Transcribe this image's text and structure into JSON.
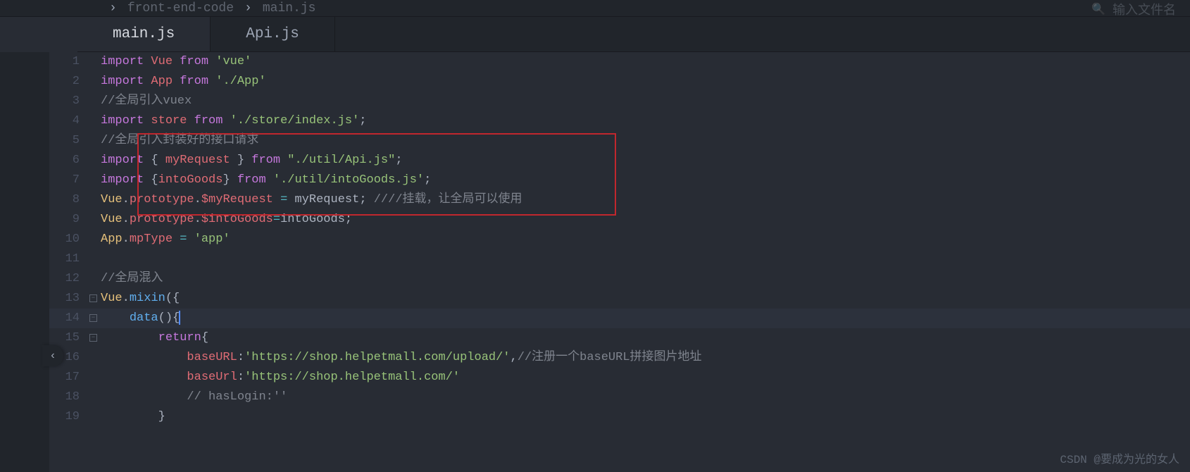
{
  "breadcrumb": {
    "item1": "front-end-code",
    "item2": "main.js",
    "sep": "›"
  },
  "search": {
    "placeholder": "输入文件名"
  },
  "tabs": {
    "tab1": "main.js",
    "tab2": "Api.js"
  },
  "code": {
    "lines": [
      {
        "num": "1",
        "tokens": [
          [
            "kw",
            "import"
          ],
          [
            "plain",
            " "
          ],
          [
            "var",
            "Vue"
          ],
          [
            "plain",
            " "
          ],
          [
            "kw",
            "from"
          ],
          [
            "plain",
            " "
          ],
          [
            "str",
            "'vue'"
          ]
        ]
      },
      {
        "num": "2",
        "tokens": [
          [
            "kw",
            "import"
          ],
          [
            "plain",
            " "
          ],
          [
            "var",
            "App"
          ],
          [
            "plain",
            " "
          ],
          [
            "kw",
            "from"
          ],
          [
            "plain",
            " "
          ],
          [
            "str",
            "'./App'"
          ]
        ]
      },
      {
        "num": "3",
        "tokens": [
          [
            "cmt",
            "//全局引入vuex"
          ]
        ]
      },
      {
        "num": "4",
        "tokens": [
          [
            "kw",
            "import"
          ],
          [
            "plain",
            " "
          ],
          [
            "var",
            "store"
          ],
          [
            "plain",
            " "
          ],
          [
            "kw",
            "from"
          ],
          [
            "plain",
            " "
          ],
          [
            "str",
            "'./store/index.js'"
          ],
          [
            "punct",
            ";"
          ]
        ]
      },
      {
        "num": "5",
        "tokens": [
          [
            "cmt",
            "//全局引入封装好的接口请求"
          ]
        ]
      },
      {
        "num": "6",
        "tokens": [
          [
            "kw",
            "import"
          ],
          [
            "plain",
            " "
          ],
          [
            "punct",
            "{ "
          ],
          [
            "var",
            "myRequest"
          ],
          [
            "punct",
            " } "
          ],
          [
            "kw",
            "from"
          ],
          [
            "plain",
            " "
          ],
          [
            "str",
            "\"./util/Api.js\""
          ],
          [
            "punct",
            ";"
          ]
        ]
      },
      {
        "num": "7",
        "tokens": [
          [
            "kw",
            "import"
          ],
          [
            "plain",
            " "
          ],
          [
            "punct",
            "{"
          ],
          [
            "var",
            "intoGoods"
          ],
          [
            "punct",
            "} "
          ],
          [
            "kw",
            "from"
          ],
          [
            "plain",
            " "
          ],
          [
            "str",
            "'./util/intoGoods.js'"
          ],
          [
            "punct",
            ";"
          ]
        ]
      },
      {
        "num": "8",
        "tokens": [
          [
            "yellow",
            "Vue"
          ],
          [
            "punct",
            "."
          ],
          [
            "prop",
            "prototype"
          ],
          [
            "punct",
            "."
          ],
          [
            "var",
            "$myRequest"
          ],
          [
            "plain",
            " "
          ],
          [
            "op",
            "="
          ],
          [
            "plain",
            " myRequest"
          ],
          [
            "punct",
            "; "
          ],
          [
            "cmt",
            "////挂载，让全局可以使用"
          ]
        ]
      },
      {
        "num": "9",
        "tokens": [
          [
            "yellow",
            "Vue"
          ],
          [
            "punct",
            "."
          ],
          [
            "prop",
            "prototype"
          ],
          [
            "punct",
            "."
          ],
          [
            "var",
            "$intoGoods"
          ],
          [
            "op",
            "="
          ],
          [
            "plain",
            "intoGoods"
          ],
          [
            "punct",
            ";"
          ]
        ]
      },
      {
        "num": "10",
        "tokens": [
          [
            "yellow",
            "App"
          ],
          [
            "punct",
            "."
          ],
          [
            "prop",
            "mpType"
          ],
          [
            "plain",
            " "
          ],
          [
            "op",
            "="
          ],
          [
            "plain",
            " "
          ],
          [
            "str",
            "'app'"
          ]
        ]
      },
      {
        "num": "11",
        "tokens": []
      },
      {
        "num": "12",
        "tokens": [
          [
            "cmt",
            "//全局混入"
          ]
        ]
      },
      {
        "num": "13",
        "tokens": [
          [
            "yellow",
            "Vue"
          ],
          [
            "punct",
            "."
          ],
          [
            "func",
            "mixin"
          ],
          [
            "punct",
            "({"
          ]
        ],
        "fold": true
      },
      {
        "num": "14",
        "tokens": [
          [
            "plain",
            "    "
          ],
          [
            "func",
            "data"
          ],
          [
            "punct",
            "(){"
          ]
        ],
        "fold": true,
        "current": true,
        "cursor": true
      },
      {
        "num": "15",
        "tokens": [
          [
            "plain",
            "        "
          ],
          [
            "kw",
            "return"
          ],
          [
            "punct",
            "{"
          ]
        ],
        "fold": true
      },
      {
        "num": "16",
        "tokens": [
          [
            "plain",
            "            "
          ],
          [
            "prop",
            "baseURL"
          ],
          [
            "punct",
            ":"
          ],
          [
            "str",
            "'https://shop.helpetmall.com/upload/'"
          ],
          [
            "punct",
            ","
          ],
          [
            "cmt",
            "//注册一个baseURL拼接图片地址"
          ]
        ]
      },
      {
        "num": "17",
        "tokens": [
          [
            "plain",
            "            "
          ],
          [
            "prop",
            "baseUrl"
          ],
          [
            "punct",
            ":"
          ],
          [
            "str",
            "'https://shop.helpetmall.com/'"
          ]
        ]
      },
      {
        "num": "18",
        "tokens": [
          [
            "plain",
            "            "
          ],
          [
            "cmt",
            "// hasLogin:''"
          ]
        ]
      },
      {
        "num": "19",
        "tokens": [
          [
            "plain",
            "        "
          ],
          [
            "punct",
            "}"
          ]
        ]
      }
    ]
  },
  "watermark": "CSDN @要成为光的女人",
  "collapse_icon": "‹"
}
